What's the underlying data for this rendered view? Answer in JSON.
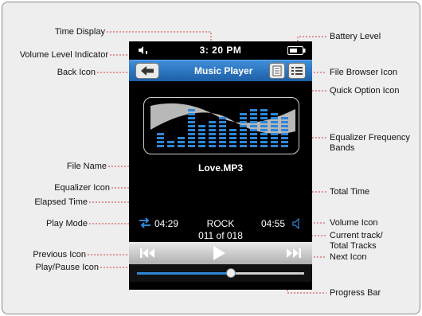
{
  "labels": {
    "time_display": "Time Display",
    "volume_level_indicator": "Volume Level Indicator",
    "back_icon": "Back Icon",
    "battery_level": "Battery Level",
    "file_browser_icon": "File Browser Icon",
    "quick_option_icon": "Quick Option Icon",
    "eq_bands_line1": "Equalizer Frequency",
    "eq_bands_line2": "Bands",
    "file_name": "File Name",
    "equalizer_icon": "Equalizer Icon",
    "elapsed_time": "Elapsed Time",
    "play_mode": "Play Mode",
    "total_time": "Total Time",
    "volume_icon": "Volume Icon",
    "current_track_line1": "Current track/",
    "current_track_line2": "Total Tracks",
    "previous_icon": "Previous Icon",
    "next_icon": "Next Icon",
    "play_pause_icon": "Play/Pause Icon",
    "progress_bar": "Progress Bar"
  },
  "screen": {
    "time": "3: 20 PM",
    "title": "Music Player",
    "file_name": "Love.MP3",
    "elapsed": "04:29",
    "total": "04:55",
    "equalizer_mode": "ROCK",
    "track_info": "011 of 018",
    "progress_fraction": 0.56,
    "eq_band_levels": [
      4,
      2,
      3,
      10,
      6,
      7,
      8,
      5,
      9,
      10,
      10,
      9,
      8
    ]
  },
  "colors": {
    "accent_blue": "#1e66b8",
    "eq_blue": "#2f86d6",
    "leader_red": "#d23a3a"
  }
}
